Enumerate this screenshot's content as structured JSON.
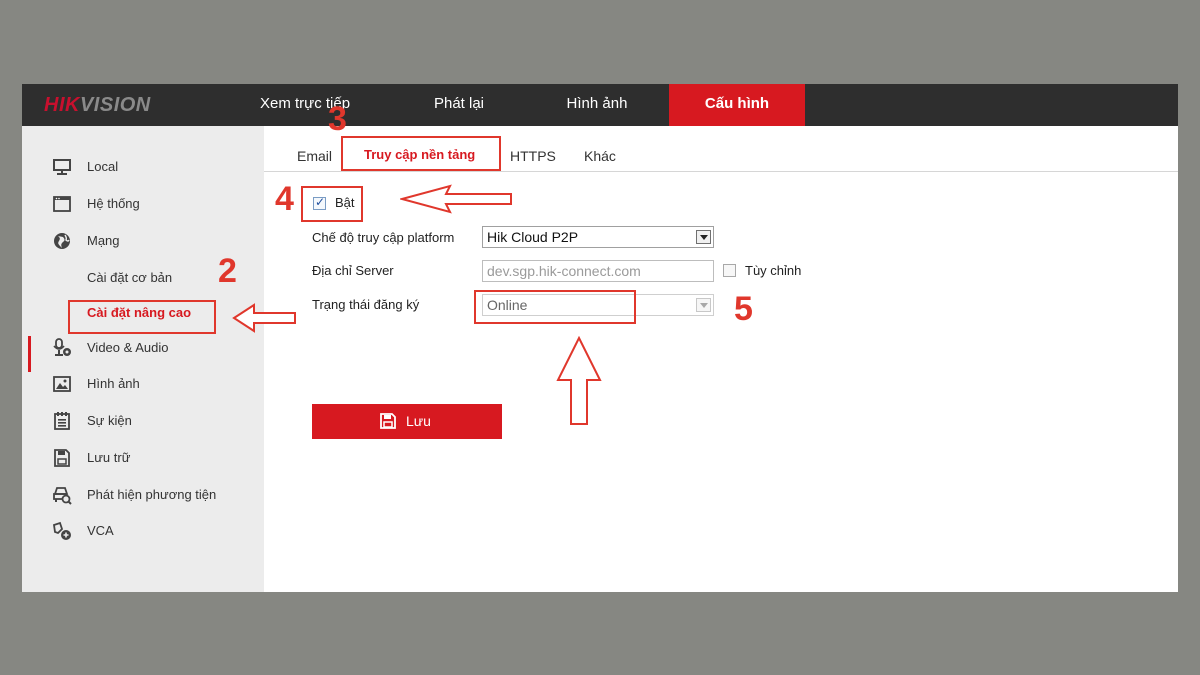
{
  "brand": {
    "logo_red": "HIK",
    "logo_grey": "VISION"
  },
  "nav": [
    {
      "label": "Xem trực tiếp"
    },
    {
      "label": "Phát lại"
    },
    {
      "label": "Hình ảnh"
    },
    {
      "label": "Cấu hình",
      "active": true
    }
  ],
  "sidebar": {
    "items": [
      {
        "label": "Local",
        "icon": "monitor-icon"
      },
      {
        "label": "Hệ thống",
        "icon": "window-icon"
      },
      {
        "label": "Mạng",
        "icon": "globe-icon"
      },
      {
        "label": "Cài đặt cơ bản",
        "sub": true
      },
      {
        "label": "Cài đặt nâng cao",
        "sub": true,
        "active": true
      },
      {
        "label": "Video & Audio",
        "icon": "microphone-icon"
      },
      {
        "label": "Hình ảnh",
        "icon": "image-icon"
      },
      {
        "label": "Sự kiện",
        "icon": "calendar-icon"
      },
      {
        "label": "Lưu trữ",
        "icon": "floppy-icon"
      },
      {
        "label": "Phát hiện phương tiện",
        "icon": "vehicle-search-icon"
      },
      {
        "label": "VCA",
        "icon": "vca-icon"
      }
    ]
  },
  "tabs": [
    {
      "label": "Email"
    },
    {
      "label": "Truy cập nền tảng",
      "active": true
    },
    {
      "label": "HTTPS"
    },
    {
      "label": "Khác"
    }
  ],
  "form": {
    "enable_label": "Bật",
    "enable_checked": true,
    "mode_label": "Chế độ truy cập platform",
    "mode_value": "Hik Cloud P2P",
    "server_label": "Địa chỉ Server",
    "server_value": "dev.sgp.hik-connect.com",
    "custom_label": "Tùy chỉnh",
    "custom_checked": false,
    "status_label": "Trạng thái đăng ký",
    "status_value": "Online",
    "save_label": "Lưu"
  },
  "annotations": {
    "n2": "2",
    "n3": "3",
    "n4": "4",
    "n5": "5"
  },
  "colors": {
    "accent": "#d71920",
    "annotation": "#e0372c",
    "topbar": "#2e2e2e",
    "sidebar": "#ececec"
  }
}
